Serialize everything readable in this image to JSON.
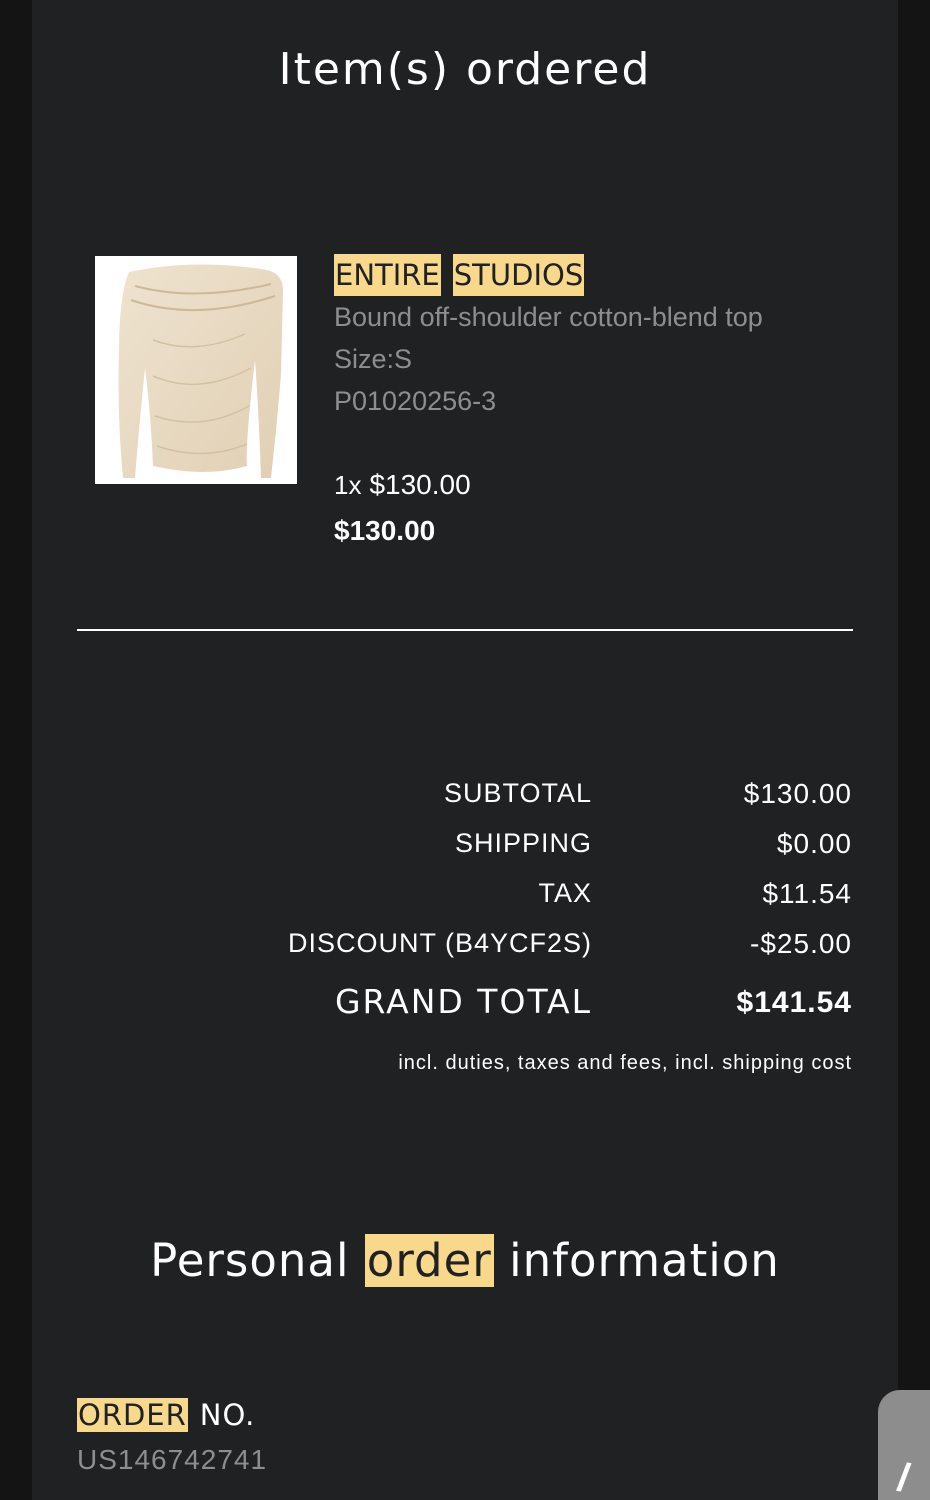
{
  "items_section": {
    "title": "Item(s) ordered",
    "product": {
      "brand_words": [
        "ENTIRE",
        "STUDIOS"
      ],
      "name": "Bound off-shoulder cotton-blend top",
      "size": "Size:S",
      "sku": "P01020256-3",
      "quantity": "1x",
      "unit_price": "$130.00",
      "line_total": "$130.00",
      "image_icon": "off-shoulder-top-photo"
    }
  },
  "totals": {
    "subtotal_label": "SUBTOTAL",
    "subtotal_value": "$130.00",
    "shipping_label": "SHIPPING",
    "shipping_value": "$0.00",
    "tax_label": "TAX",
    "tax_value": "$11.54",
    "discount_label": "DISCOUNT (B4YCF2S)",
    "discount_value": "-$25.00",
    "grand_label": "GRAND TOTAL",
    "grand_value": "$141.54",
    "note": "incl. duties, taxes and fees, incl. shipping cost"
  },
  "personal_section": {
    "title_before": "Personal",
    "title_highlight": "order",
    "title_after": "information",
    "order_label_highlight": "ORDER",
    "order_label_rest": "NO.",
    "order_number": "US146742741"
  },
  "chat_widget": {
    "icon": "chat-bubble-icon",
    "glyph": "/"
  },
  "colors": {
    "panel_bg": "#202123",
    "outer_bg": "#141414",
    "highlight": "#f8d98c",
    "muted_text": "#8e8e8e"
  }
}
